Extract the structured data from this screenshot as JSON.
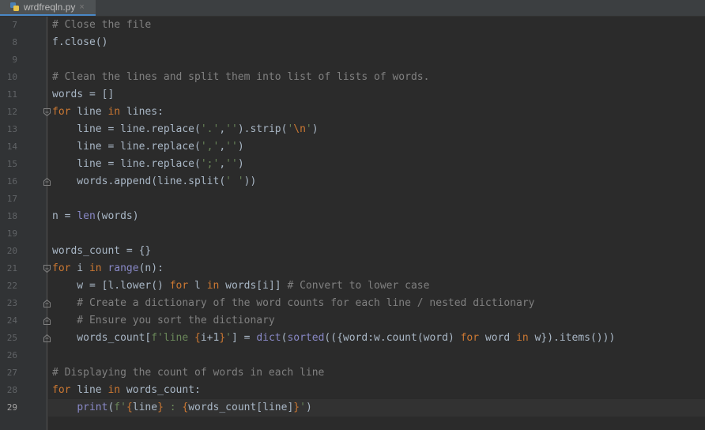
{
  "tab": {
    "filename": "wrdfreqln.py",
    "close": "×"
  },
  "current_line": "29",
  "lines": [
    {
      "num": "7",
      "code": "# Close the file"
    },
    {
      "num": "8",
      "code": "f.close()"
    },
    {
      "num": "9",
      "code": ""
    },
    {
      "num": "10",
      "code": "# Clean the lines and split them into list of lists of words."
    },
    {
      "num": "11",
      "code": "words = []"
    },
    {
      "num": "12",
      "code": "for line in lines:"
    },
    {
      "num": "13",
      "code": "    line = line.replace('.','').strip('\\n')"
    },
    {
      "num": "14",
      "code": "    line = line.replace(',','')"
    },
    {
      "num": "15",
      "code": "    line = line.replace(';','')"
    },
    {
      "num": "16",
      "code": "    words.append(line.split(' '))"
    },
    {
      "num": "17",
      "code": ""
    },
    {
      "num": "18",
      "code": "n = len(words)"
    },
    {
      "num": "19",
      "code": ""
    },
    {
      "num": "20",
      "code": "words_count = {}"
    },
    {
      "num": "21",
      "code": "for i in range(n):"
    },
    {
      "num": "22",
      "code": "    w = [l.lower() for l in words[i]] # Convert to lower case"
    },
    {
      "num": "23",
      "code": "    # Create a dictionary of the word counts for each line / nested dictionary"
    },
    {
      "num": "24",
      "code": "    # Ensure you sort the dictionary"
    },
    {
      "num": "25",
      "code": "    words_count[f'line {i+1}'] = dict(sorted(({word:w.count(word) for word in w}).items()))"
    },
    {
      "num": "26",
      "code": ""
    },
    {
      "num": "27",
      "code": "# Displaying the count of words in each line"
    },
    {
      "num": "28",
      "code": "for line in words_count:"
    },
    {
      "num": "29",
      "code": "    print(f'{line} : {words_count[line]}')"
    }
  ]
}
